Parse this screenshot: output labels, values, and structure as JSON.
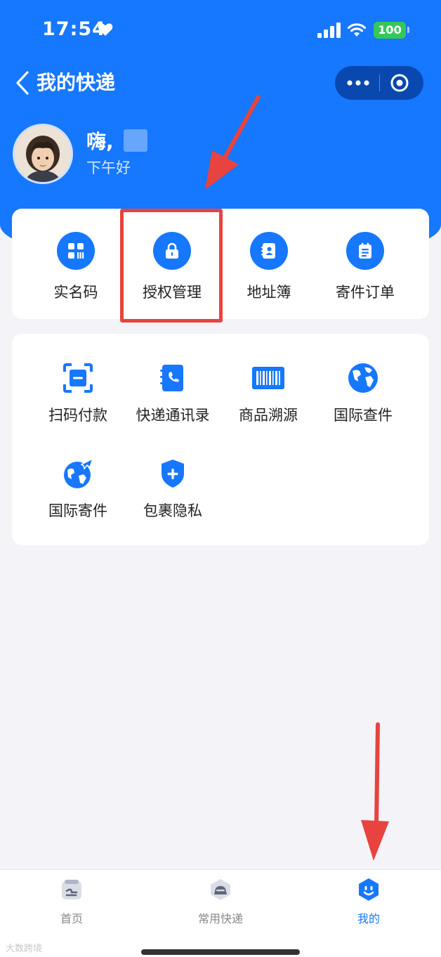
{
  "status_bar": {
    "time": "17:54",
    "battery": "100"
  },
  "nav": {
    "title": "我的快递"
  },
  "profile": {
    "greeting": "嗨,",
    "subgreeting": "下午好"
  },
  "quick_actions": [
    {
      "label": "实名码",
      "icon": "qr-code-icon"
    },
    {
      "label": "授权管理",
      "icon": "lock-icon"
    },
    {
      "label": "地址簿",
      "icon": "address-book-icon"
    },
    {
      "label": "寄件订单",
      "icon": "order-list-icon"
    }
  ],
  "services": [
    {
      "label": "扫码付款",
      "icon": "scan-icon"
    },
    {
      "label": "快递通讯录",
      "icon": "phone-book-icon"
    },
    {
      "label": "商品溯源",
      "icon": "barcode-icon"
    },
    {
      "label": "国际查件",
      "icon": "globe-icon"
    },
    {
      "label": "国际寄件",
      "icon": "globe-plane-icon"
    },
    {
      "label": "包裹隐私",
      "icon": "shield-plus-icon"
    }
  ],
  "tabbar": [
    {
      "label": "首页",
      "icon": "home-box-icon",
      "active": false
    },
    {
      "label": "常用快递",
      "icon": "courier-icon",
      "active": false
    },
    {
      "label": "我的",
      "icon": "profile-face-icon",
      "active": true
    }
  ],
  "watermark": "大数跨境",
  "colors": {
    "brand": "#1677ff",
    "highlight": "#e8433e",
    "background": "#f3f3f8"
  }
}
